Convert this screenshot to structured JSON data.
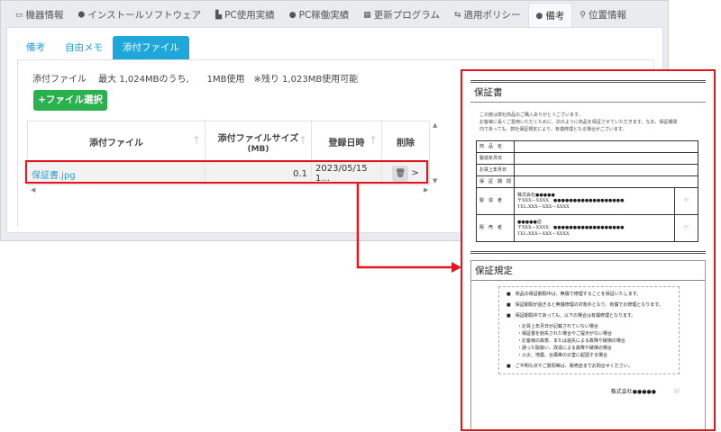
{
  "tabs": [
    {
      "label": "機器情報",
      "icon": "monitor-icon"
    },
    {
      "label": "インストールソフトウェア",
      "icon": "package-icon"
    },
    {
      "label": "PC使用実績",
      "icon": "chart-icon"
    },
    {
      "label": "PC稼働実績",
      "icon": "clock-icon"
    },
    {
      "label": "更新プログラム",
      "icon": "windows-icon"
    },
    {
      "label": "適用ポリシー",
      "icon": "usb-icon"
    },
    {
      "label": "備考",
      "icon": "comment-icon",
      "active": true
    },
    {
      "label": "位置情報",
      "icon": "map-marker-icon"
    }
  ],
  "subtabs": [
    "備考",
    "自由メモ",
    "添付ファイル"
  ],
  "info": "添付ファイル　 最大 1,024MBのうち,　　1MB使用　※残り 1,023MB使用可能",
  "select_button": "+ファイル選択",
  "table": {
    "headers": [
      "添付ファイル",
      "添付ファイルサイズ",
      "(MB)",
      "登録日時",
      "削除"
    ],
    "rows": [
      {
        "file": "保証書.jpg",
        "size": "0.1",
        "date": "2023/05/15 1...",
        "more": ">"
      }
    ]
  },
  "doc": {
    "title": "保証書",
    "intro": [
      "この度は弊社商品のご購入ありがとうございます。",
      "お客様に長くご愛用いただくために、次のように商品を保証させていただきます。なお、保証期間",
      "内であっても、弊社保証規定により、有償修理となる場合がございます。"
    ],
    "fields": [
      "商　品　名",
      "製造年月日",
      "お買上年月日",
      "保　証　期　間",
      "製　造　者",
      "販　売　者"
    ],
    "maker": [
      "株式会社●●●●●",
      "〒XXX－XXXX　●●●●●●●●●●●●●●●●●●",
      "TEL:XXX－XXX－XXXX"
    ],
    "seller": [
      "●●●●●店",
      "〒XXX－XXXX　●●●●●●●●●●●●●●●●●●",
      "TEL:XXX－XXX－XXXX"
    ],
    "seal": "印",
    "rules_title": "保証規定",
    "rules": [
      "商品の保証期間中は、無償で修理することを保証いたします。",
      "保証期間が過ぎると無償修理の対象外となり、有償での修理となります。",
      "保証期間中であっても、以下の場合は有償修理となります。"
    ],
    "subrules": [
      "・お買上年月日が記載されていない場合",
      "・保証書を紛失された場合やご提示がない場合",
      "・お客様の故意、または過失による故障や破損の場合",
      "・誤った取扱い、改造による故障や破損の場合",
      "・火災、地震、台風等の災害に起因する場合"
    ],
    "last_rule": "ご不明な点やご質問等は、販売店までお問合せください。",
    "company": "株式会社●●●●●"
  }
}
